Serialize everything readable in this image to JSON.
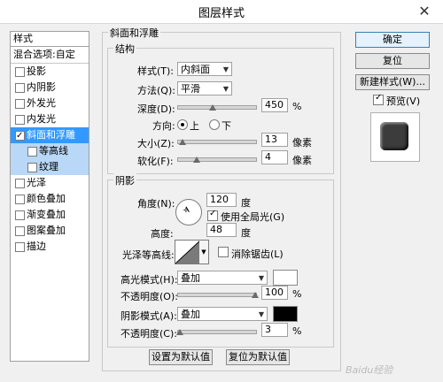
{
  "window": {
    "title": "图层样式",
    "close_glyph": "✕"
  },
  "left_panel": {
    "header": "样式",
    "blend_item": "混合选项:自定",
    "items": [
      {
        "label": "投影",
        "checked": false
      },
      {
        "label": "内阴影",
        "checked": false
      },
      {
        "label": "外发光",
        "checked": false
      },
      {
        "label": "内发光",
        "checked": false
      },
      {
        "label": "斜面和浮雕",
        "checked": true,
        "selected": true
      },
      {
        "label": "等高线",
        "checked": false,
        "sub": true
      },
      {
        "label": "纹理",
        "checked": false,
        "sub": true
      },
      {
        "label": "光泽",
        "checked": false
      },
      {
        "label": "颜色叠加",
        "checked": false
      },
      {
        "label": "渐变叠加",
        "checked": false
      },
      {
        "label": "图案叠加",
        "checked": false
      },
      {
        "label": "描边",
        "checked": false
      }
    ]
  },
  "bevel": {
    "group_title": "斜面和浮雕",
    "structure": {
      "title": "结构",
      "style_label": "样式(T):",
      "style_value": "内斜面",
      "method_label": "方法(Q):",
      "method_value": "平滑",
      "depth_label": "深度(D):",
      "depth_value": "450",
      "depth_unit": "%",
      "direction_label": "方向:",
      "dir_up": "上",
      "dir_down": "下",
      "size_label": "大小(Z):",
      "size_value": "13",
      "size_unit": "像素",
      "soften_label": "软化(F):",
      "soften_value": "4",
      "soften_unit": "像素"
    },
    "shading": {
      "title": "阴影",
      "angle_label": "角度(N):",
      "angle_value": "120",
      "angle_unit": "度",
      "global_light_label": "使用全局光(G)",
      "global_light_checked": true,
      "altitude_label": "高度:",
      "altitude_value": "48",
      "altitude_unit": "度",
      "gloss_label": "光泽等高线:",
      "antialias_label": "消除锯齿(L)",
      "antialias_checked": false,
      "highlight_mode_label": "高光模式(H):",
      "highlight_mode_value": "叠加",
      "highlight_color": "#ffffff",
      "highlight_opacity_label": "不透明度(O):",
      "highlight_opacity_value": "100",
      "highlight_opacity_unit": "%",
      "shadow_mode_label": "阴影模式(A):",
      "shadow_mode_value": "叠加",
      "shadow_color": "#000000",
      "shadow_opacity_label": "不透明度(C):",
      "shadow_opacity_value": "3",
      "shadow_opacity_unit": "%"
    },
    "make_default_label": "设置为默认值",
    "reset_default_label": "复位为默认值"
  },
  "right": {
    "ok_label": "确定",
    "reset_label": "复位",
    "new_style_label": "新建样式(W)...",
    "preview_label": "预览(V)",
    "preview_checked": true
  },
  "watermark": "Baidu经验",
  "levels": {
    "depth": 0.45,
    "size": 0.05,
    "soften": 0.25,
    "highlight_opacity": 1.0,
    "shadow_opacity": 0.03
  }
}
